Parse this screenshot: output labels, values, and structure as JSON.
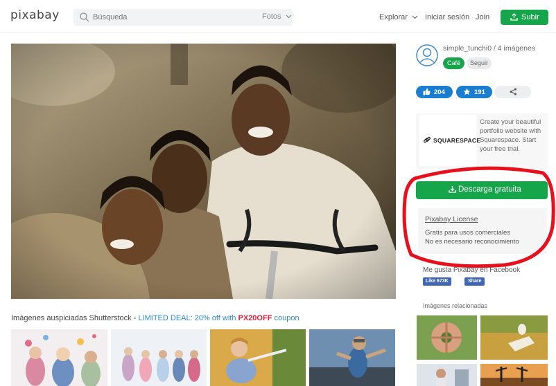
{
  "header": {
    "logo": "pixabay",
    "search_placeholder": "Búsqueda",
    "search_type": "Fotos",
    "nav": {
      "explore": "Explorar",
      "login": "Iniciar sesión",
      "join": "Join",
      "upload": "Subir"
    }
  },
  "author": {
    "line": "simple_tunchi0 / 4 imágenes",
    "coffee_label": "Café",
    "follow_label": "Seguir"
  },
  "actions": {
    "likes": "204",
    "favorites": "191"
  },
  "ad": {
    "brand": "SQUARESPACE",
    "text": "Create your beautiful portfolio website with Squarespace. Start your free trial."
  },
  "download": {
    "label": "Descarga gratuita"
  },
  "license": {
    "title": "Pixabay License",
    "line1": "Gratis para usos comerciales",
    "line2": "No es necesario reconocimiento"
  },
  "facebook": {
    "text": "Me gusta Pixabay en Facebook",
    "like_label": "Like 673K",
    "share_label": "Share"
  },
  "sponsored": {
    "prefix": "Imágenes auspiciadas Shutterstock - ",
    "deal": "LIMITED DEAL: 20% off with ",
    "code": "PX20OFF",
    "suffix": " coupon"
  },
  "related": {
    "label": "Imágenes relacionadas"
  },
  "colors": {
    "primary_green": "#16a54a",
    "blue": "#1a7ed0",
    "highlight_red": "#e8101c",
    "deal_blue": "#2d8ccf",
    "code_red": "#e0213c"
  },
  "icons": [
    "search-icon",
    "chevron-down-icon",
    "upload-icon",
    "thumbs-up-icon",
    "star-icon",
    "share-icon",
    "download-icon",
    "avatar-icon"
  ]
}
